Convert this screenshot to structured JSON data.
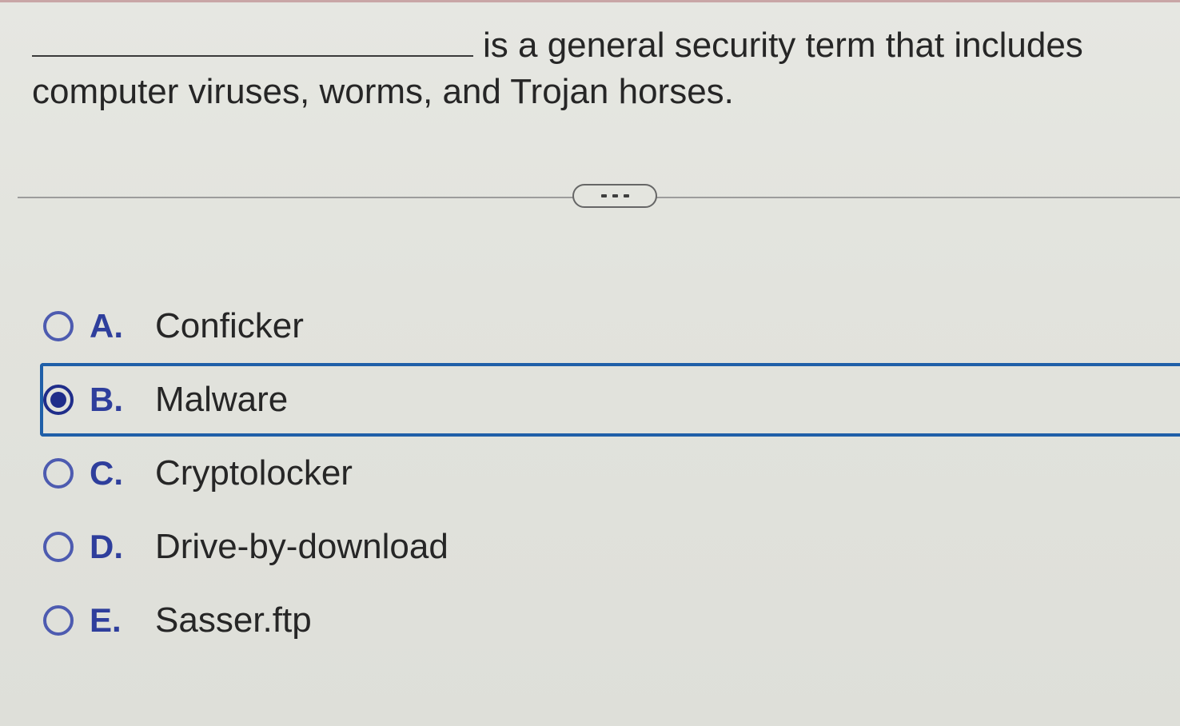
{
  "question": {
    "text_after_blank": "is a general security term that includes computer viruses, worms, and Trojan horses."
  },
  "expand_button": {
    "label": "..."
  },
  "options": [
    {
      "letter": "A.",
      "text": "Conficker",
      "selected": false
    },
    {
      "letter": "B.",
      "text": "Malware",
      "selected": true
    },
    {
      "letter": "C.",
      "text": "Cryptolocker",
      "selected": false
    },
    {
      "letter": "D.",
      "text": "Drive-by-download",
      "selected": false
    },
    {
      "letter": "E.",
      "text": "Sasser.ftp",
      "selected": false
    }
  ],
  "colors": {
    "selection_border": "#1f5fa8",
    "radio_ring": "#4d5bb0",
    "radio_fill": "#1f2d8a",
    "option_letter": "#2e3e9c"
  }
}
